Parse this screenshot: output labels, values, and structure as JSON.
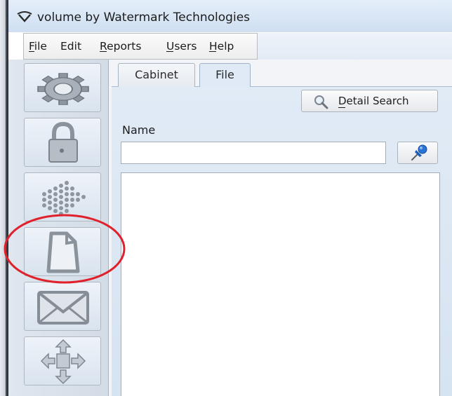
{
  "window": {
    "title": "volume by Watermark Technologies",
    "app_icon": "watermark-logo-icon"
  },
  "menu": {
    "items": [
      {
        "label": "File",
        "accel": "F"
      },
      {
        "label": "Edit",
        "accel": ""
      },
      {
        "label": "Reports",
        "accel": "R"
      },
      {
        "label": "Users",
        "accel": "U"
      },
      {
        "label": "Help",
        "accel": "H"
      }
    ]
  },
  "sidebar": {
    "buttons": [
      {
        "icon": "gear-icon",
        "active": false
      },
      {
        "icon": "padlock-icon",
        "active": false
      },
      {
        "icon": "dotted-arrow-icon",
        "active": false
      },
      {
        "icon": "document-icon",
        "active": false,
        "highlighted": true
      },
      {
        "icon": "envelope-icon",
        "active": false
      },
      {
        "icon": "four-way-arrows-icon",
        "active": false
      }
    ]
  },
  "tabs": [
    {
      "label": "Cabinet",
      "selected": false
    },
    {
      "label": "File",
      "selected": true
    }
  ],
  "file_tab": {
    "detail_search_label": "Detail Search",
    "detail_search_icon": "magnifier-icon",
    "name_label": "Name",
    "name_value": "",
    "pin_icon": "pushpin-icon"
  },
  "colors": {
    "panel": "#dae6f3",
    "highlight": "#e0202a"
  }
}
